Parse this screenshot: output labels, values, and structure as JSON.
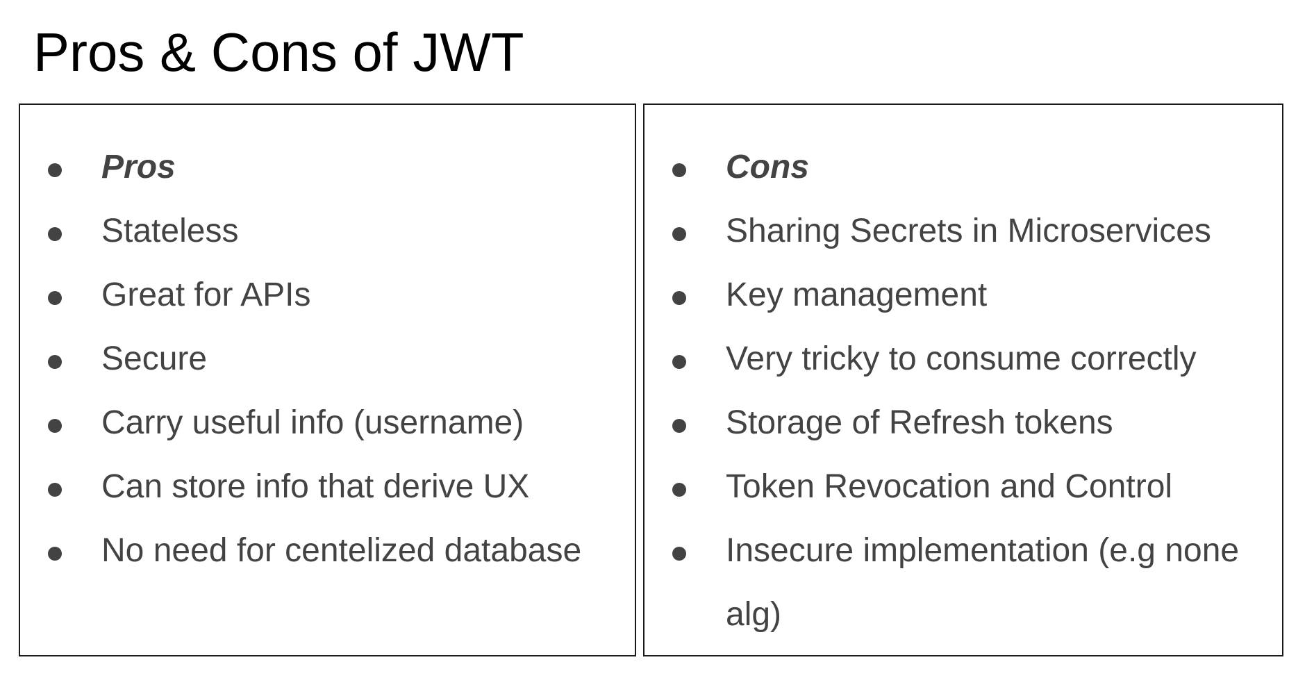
{
  "title": "Pros & Cons of JWT",
  "pros": {
    "heading": "Pros",
    "items": [
      "Stateless",
      "Great for APIs",
      "Secure",
      "Carry useful info (username)",
      "Can store info that derive UX",
      "No need for centelized database"
    ]
  },
  "cons": {
    "heading": "Cons",
    "items": [
      "Sharing Secrets in Microservices",
      "Key management",
      "Very tricky to consume correctly",
      "Storage of Refresh tokens",
      "Token Revocation and Control",
      "Insecure implementation (e.g none alg)"
    ]
  },
  "colors": {
    "title": "#000000",
    "bullet_text": "#434343",
    "border": "#1a1a1a"
  }
}
